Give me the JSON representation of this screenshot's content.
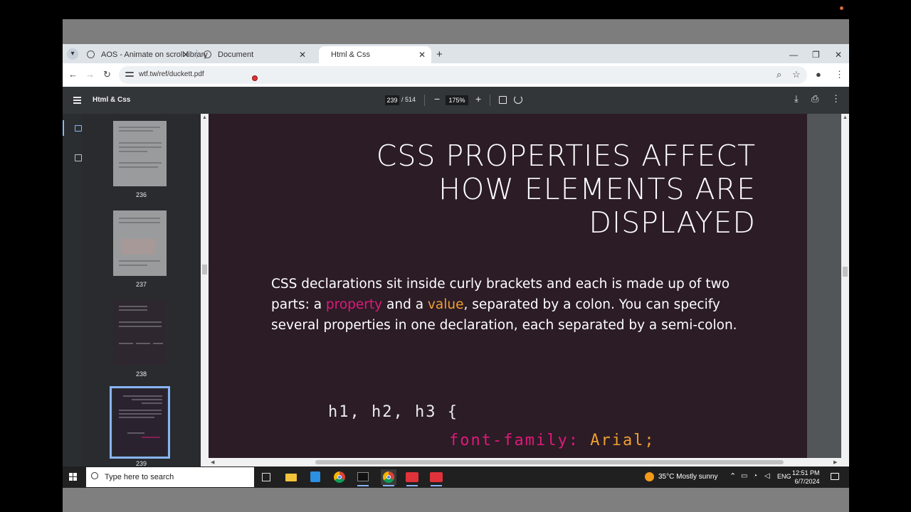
{
  "browser": {
    "tabs": [
      {
        "label": "AOS - Animate on scroll library",
        "active": false
      },
      {
        "label": "Document",
        "active": false
      },
      {
        "label": "Html & Css",
        "active": true
      }
    ],
    "url": "wtf.tw/ref/duckett.pdf",
    "icons": {
      "tab_search": "chevron-down-icon",
      "new_tab": "plus-icon",
      "minimize": "minimize-icon",
      "restore": "restore-icon",
      "close": "close-icon",
      "back": "back-arrow-icon",
      "forward": "forward-arrow-icon",
      "reload": "reload-icon",
      "zoom": "zoom-icon",
      "bookmark": "star-icon",
      "profile": "profile-icon",
      "menu": "kebab-menu-icon"
    }
  },
  "pdf_viewer": {
    "title": "Html & Css",
    "current_page": "239",
    "total_pages": "/ 514",
    "zoom": "175%",
    "thumbnails": [
      {
        "page": "236"
      },
      {
        "page": "237"
      },
      {
        "page": "238"
      },
      {
        "page": "239",
        "selected": true
      }
    ]
  },
  "page_content": {
    "heading_lines": [
      "CSS PROPERTIES AFFECT",
      "HOW ELEMENTS ARE",
      "DISPLAYED"
    ],
    "para_part1": "CSS declarations sit inside curly brackets and each is made up of two parts: a ",
    "para_property": "property",
    "para_part2": " and a ",
    "para_value": "value",
    "para_part3": ", separated by a colon. You can specify several properties in one declaration, each separated by a semi-colon.",
    "code_line1": "h1, h2, h3 {",
    "code_prop": "font-family:",
    "code_val": "Arial;"
  },
  "taskbar": {
    "search_placeholder": "Type here to search",
    "weather": "35°C  Mostly sunny",
    "language": "ENG",
    "time": "12:51 PM",
    "date": "6/7/2024"
  },
  "colors": {
    "page_bg": "#2b1c26",
    "property_pink": "#e0197a",
    "value_orange": "#f0a030",
    "accent_blue": "#8ab4f8"
  }
}
